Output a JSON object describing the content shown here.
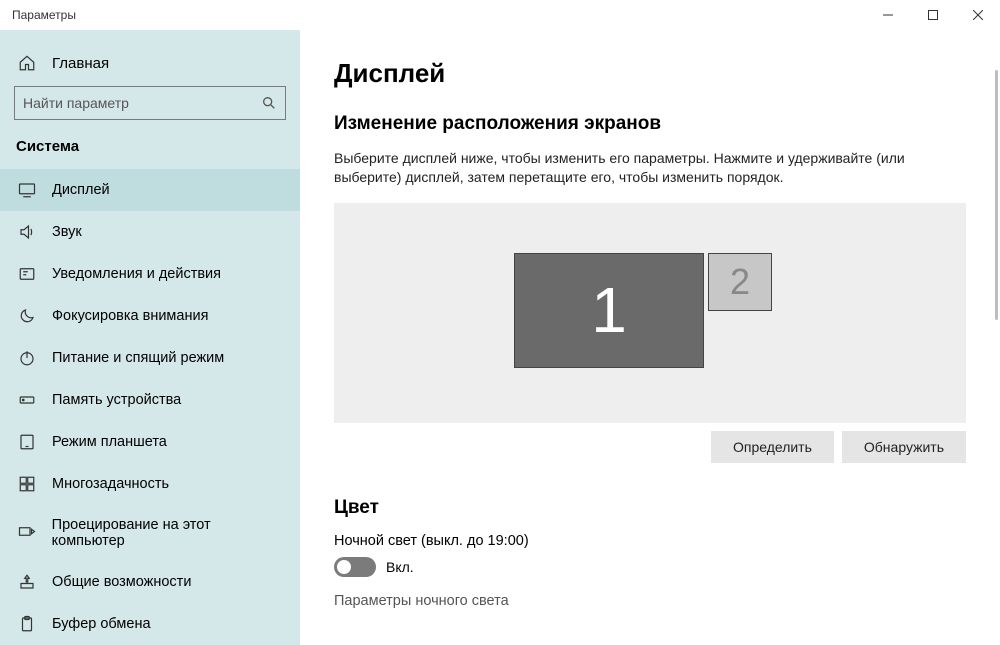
{
  "window": {
    "title": "Параметры"
  },
  "sidebar": {
    "home_label": "Главная",
    "search_placeholder": "Найти параметр",
    "category": "Система",
    "items": [
      {
        "label": "Дисплей"
      },
      {
        "label": "Звук"
      },
      {
        "label": "Уведомления и действия"
      },
      {
        "label": "Фокусировка внимания"
      },
      {
        "label": "Питание и спящий режим"
      },
      {
        "label": "Память устройства"
      },
      {
        "label": "Режим планшета"
      },
      {
        "label": "Многозадачность"
      },
      {
        "label": "Проецирование на этот компьютер"
      },
      {
        "label": "Общие возможности"
      },
      {
        "label": "Буфер обмена"
      }
    ]
  },
  "content": {
    "title": "Дисплей",
    "arrange_heading": "Изменение расположения экранов",
    "arrange_desc": "Выберите дисплей ниже, чтобы изменить его параметры. Нажмите и удерживайте (или выберите) дисплей, затем перетащите его, чтобы изменить порядок.",
    "monitor1": "1",
    "monitor2": "2",
    "identify_btn": "Определить",
    "detect_btn": "Обнаружить",
    "color_heading": "Цвет",
    "night_light_label": "Ночной свет (выкл. до 19:00)",
    "toggle_state_label": "Вкл.",
    "night_light_settings": "Параметры ночного света"
  }
}
